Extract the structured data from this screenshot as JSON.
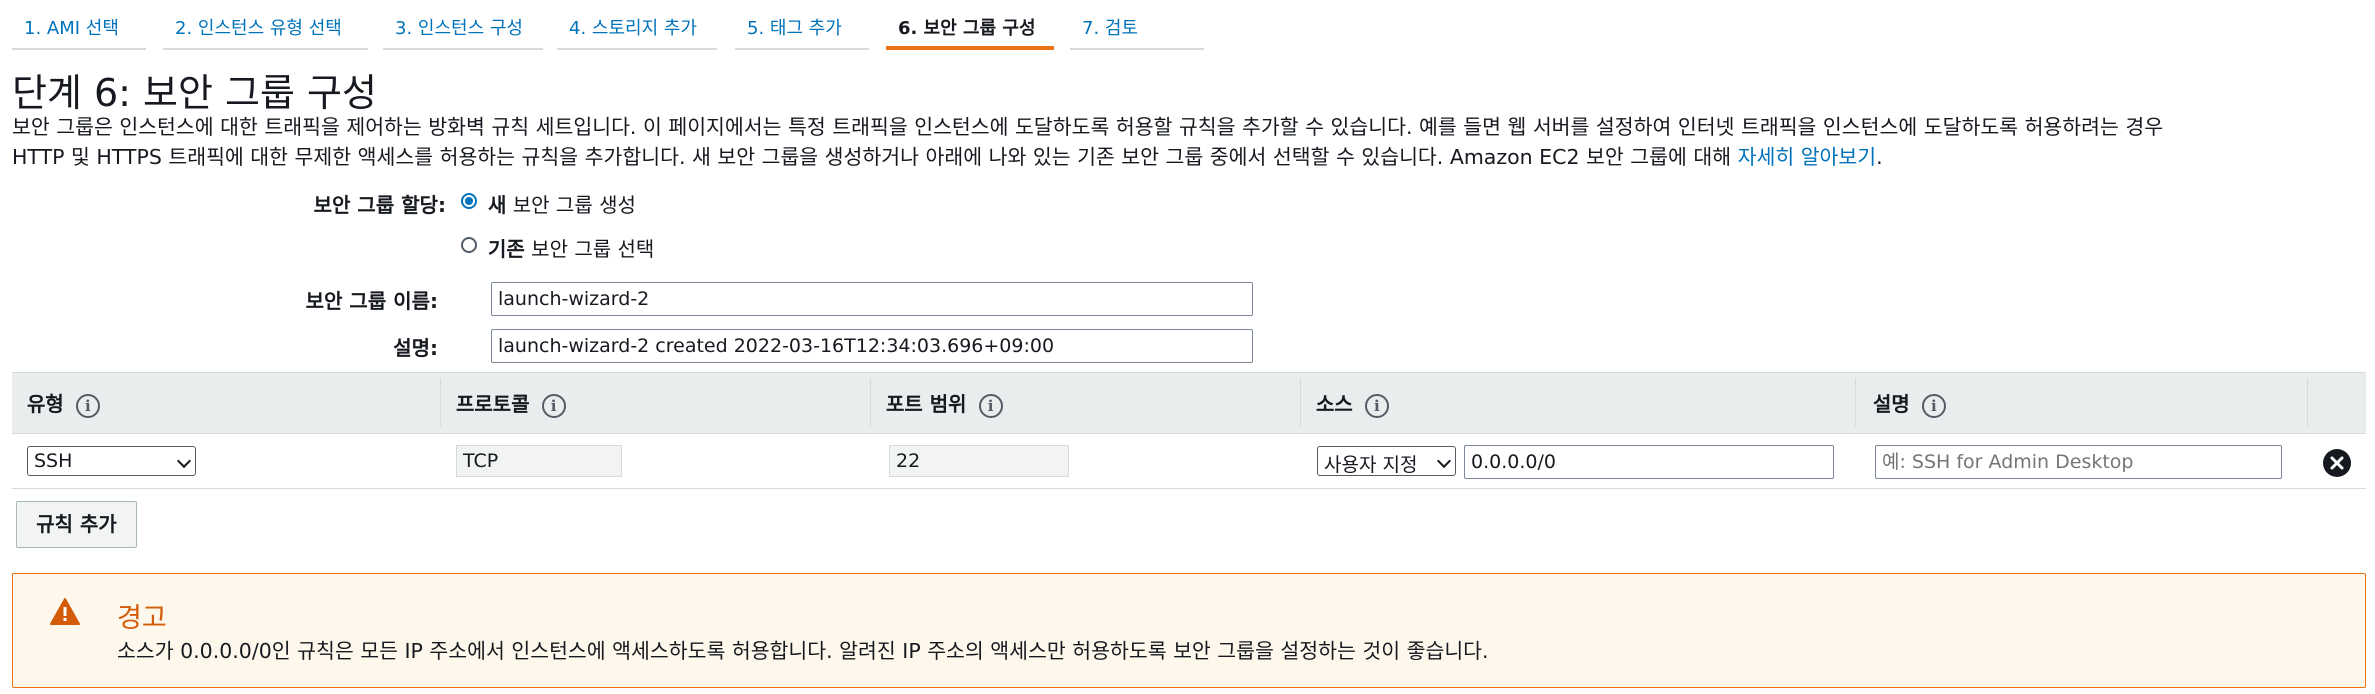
{
  "tabs": [
    {
      "label": "1. AMI 선택",
      "active": false
    },
    {
      "label": "2. 인스턴스 유형 선택",
      "active": false
    },
    {
      "label": "3. 인스턴스 구성",
      "active": false
    },
    {
      "label": "4. 스토리지 추가",
      "active": false
    },
    {
      "label": "5. 태그 추가",
      "active": false
    },
    {
      "label": "6. 보안 그룹 구성",
      "active": true
    },
    {
      "label": "7. 검토",
      "active": false
    }
  ],
  "page": {
    "title": "단계 6: 보안 그룹 구성",
    "desc_line1": "보안 그룹은 인스턴스에 대한 트래픽을 제어하는 방화벽 규칙 세트입니다. 이 페이지에서는 특정 트래픽을 인스턴스에 도달하도록 허용할 규칙을 추가할 수 있습니다. 예를 들면 웹 서버를 설정하여 인터넷 트래픽을 인스턴스에 도달하도록 허용하려는 경우",
    "desc_line2": "HTTP 및 HTTPS 트래픽에 대한 무제한 액세스를 허용하는 규칙을 추가합니다. 새 보안 그룹을 생성하거나 아래에 나와 있는 기존 보안 그룹 중에서 선택할 수 있습니다. Amazon EC2 보안 그룹에 대해 ",
    "learn_more": "자세히 알아보기",
    "period": "."
  },
  "assign": {
    "label": "보안 그룹 할당:",
    "option_new_bold": "새",
    "option_new_rest": " 보안 그룹 생성",
    "option_existing_bold": "기존",
    "option_existing_rest": " 보안 그룹 선택",
    "selected": "new"
  },
  "name_field": {
    "label": "보안 그룹 이름:",
    "value": "launch-wizard-2"
  },
  "desc_field": {
    "label": "설명:",
    "value": "launch-wizard-2 created 2022-03-16T12:34:03.696+09:00"
  },
  "table": {
    "headers": [
      "유형",
      "프로토콜",
      "포트 범위",
      "소스",
      "설명"
    ],
    "rows": [
      {
        "type": "SSH",
        "protocol": "TCP",
        "port": "22",
        "source_select": "사용자 지정",
        "source_value": "0.0.0.0/0",
        "description_placeholder": "예: SSH for Admin Desktop"
      }
    ]
  },
  "add_rule_label": "규칙 추가",
  "warning": {
    "title": "경고",
    "text": "소스가 0.0.0.0/0인 규칙은 모든 IP 주소에서 인스턴스에 액세스하도록 허용합니다. 알려진 IP 주소의 액세스만 허용하도록 보안 그룹을 설정하는 것이 좋습니다."
  },
  "colors": {
    "accent": "#ec7211",
    "link": "#0073bb",
    "warning_bg": "#fef8ec",
    "warning_title": "#d45b07"
  }
}
